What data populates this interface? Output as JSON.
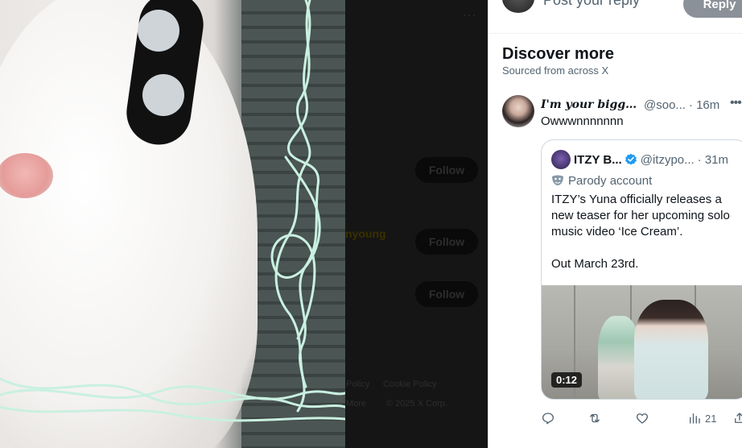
{
  "background": {
    "follow_buttons": [
      "Follow",
      "Follow",
      "Follow"
    ],
    "ghost_name": "nyoung",
    "footer_links": [
      "Policy",
      "Cookie Policy",
      "More",
      "© 2025 X Corp."
    ]
  },
  "reply": {
    "placeholder": "Post your reply",
    "button_label": "Reply"
  },
  "discover": {
    "title": "Discover more",
    "subtitle": "Sourced from across X"
  },
  "post": {
    "display_name": "I'm your biggest fan",
    "handle": "@soo...",
    "time": "· 16m",
    "text": "Owwwnnnnnnn",
    "quote": {
      "name": "ITZY B...",
      "handle": "@itzypo...",
      "time": "· 31m",
      "label": "Parody account",
      "body_p1": "ITZY’s Yuna officially releases a new teaser for her upcoming solo music video ‘Ice Cream’.",
      "body_p2": "Out March 23rd.",
      "video_duration": "0:12"
    },
    "actions": {
      "views": "21"
    }
  },
  "colors": {
    "verified": "#1d9bf0",
    "text_primary": "#0f1419",
    "text_secondary": "#536471"
  }
}
